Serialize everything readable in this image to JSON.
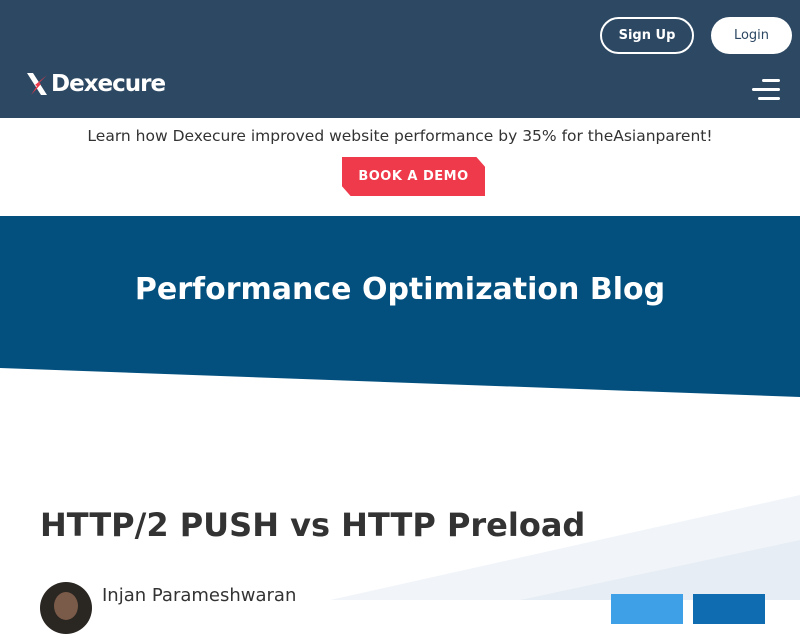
{
  "header": {
    "logo_text": "Dexecure",
    "signup_label": "Sign Up",
    "login_label": "Login"
  },
  "announcement": {
    "text": "Learn how Dexecure improved website performance by 35% for theAsianparent!",
    "cta_label": "BOOK A DEMO"
  },
  "hero": {
    "title": "Performance Optimization Blog"
  },
  "post": {
    "title": "HTTP/2 PUSH vs HTTP Preload",
    "author": "Injan Parameshwaran"
  },
  "colors": {
    "header_bg": "#2c4863",
    "hero_bg": "#03507f",
    "accent": "#ee3a4b",
    "twitter": "#3ea0e6",
    "linkedin": "#0f6cb0"
  },
  "icons": [
    "dexecure-logo-icon",
    "menu-icon",
    "twitter-share-icon",
    "linkedin-share-icon"
  ]
}
